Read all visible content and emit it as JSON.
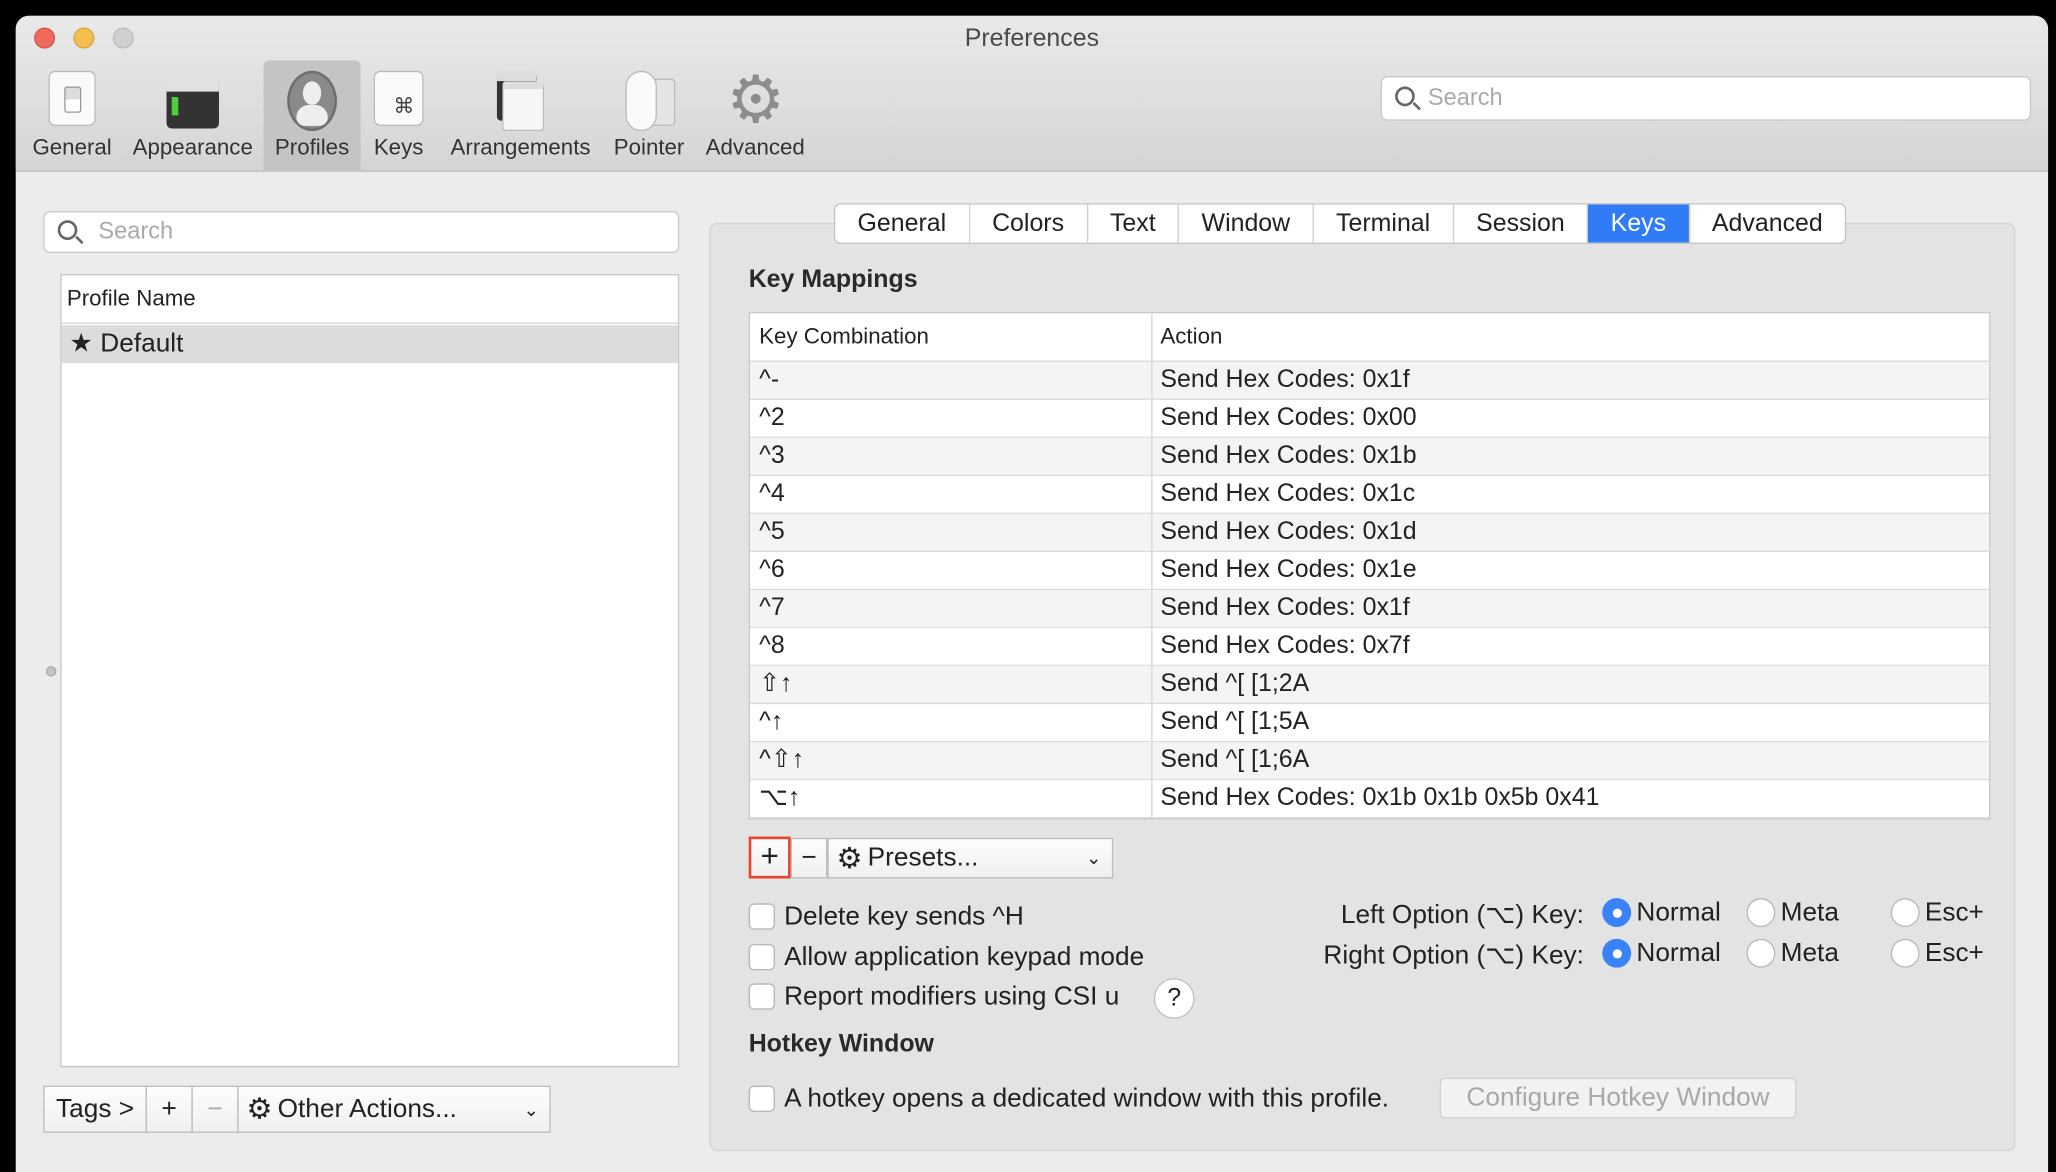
{
  "window": {
    "title": "Preferences"
  },
  "toolbar": {
    "items": [
      {
        "label": "General",
        "icon": "switch-icon"
      },
      {
        "label": "Appearance",
        "icon": "terminal-window-icon"
      },
      {
        "label": "Profiles",
        "icon": "person-icon",
        "selected": true
      },
      {
        "label": "Keys",
        "icon": "command-key-icon"
      },
      {
        "label": "Arrangements",
        "icon": "windows-icon"
      },
      {
        "label": "Pointer",
        "icon": "mouse-icon"
      },
      {
        "label": "Advanced",
        "icon": "gear-icon"
      }
    ],
    "search_placeholder": "Search"
  },
  "profiles": {
    "search_placeholder": "Search",
    "column": "Profile Name",
    "items": [
      {
        "name": "Default",
        "default": true
      }
    ],
    "tags_label": "Tags >",
    "add_label": "+",
    "remove_label": "−",
    "other_actions_label": "Other Actions..."
  },
  "tabs": [
    {
      "label": "General"
    },
    {
      "label": "Colors"
    },
    {
      "label": "Text"
    },
    {
      "label": "Window"
    },
    {
      "label": "Terminal"
    },
    {
      "label": "Session"
    },
    {
      "label": "Keys",
      "selected": true
    },
    {
      "label": "Advanced"
    }
  ],
  "key_mappings": {
    "title": "Key Mappings",
    "columns": [
      "Key Combination",
      "Action"
    ],
    "rows": [
      {
        "key": "^-",
        "action": "Send Hex Codes: 0x1f"
      },
      {
        "key": "^2",
        "action": "Send Hex Codes: 0x00"
      },
      {
        "key": "^3",
        "action": "Send Hex Codes: 0x1b"
      },
      {
        "key": "^4",
        "action": "Send Hex Codes: 0x1c"
      },
      {
        "key": "^5",
        "action": "Send Hex Codes: 0x1d"
      },
      {
        "key": "^6",
        "action": "Send Hex Codes: 0x1e"
      },
      {
        "key": "^7",
        "action": "Send Hex Codes: 0x1f"
      },
      {
        "key": "^8",
        "action": "Send Hex Codes: 0x7f"
      },
      {
        "key": "⇧↑",
        "action": "Send ^[ [1;2A"
      },
      {
        "key": "^↑",
        "action": "Send ^[ [1;5A"
      },
      {
        "key": "^⇧↑",
        "action": "Send ^[ [1;6A"
      },
      {
        "key": "⌥↑",
        "action": "Send Hex Codes: 0x1b 0x1b 0x5b 0x41"
      }
    ],
    "add_label": "+",
    "remove_label": "−",
    "presets_label": "Presets..."
  },
  "options": {
    "delete_sends_h": {
      "label": "Delete key sends ^H",
      "checked": false
    },
    "keypad_mode": {
      "label": "Allow application keypad mode",
      "checked": false
    },
    "csi_u": {
      "label": "Report modifiers using CSI u",
      "checked": false
    },
    "help_label": "?",
    "left_option": {
      "label": "Left Option (⌥) Key:",
      "choices": [
        "Normal",
        "Meta",
        "Esc+"
      ],
      "selected": "Normal"
    },
    "right_option": {
      "label": "Right Option (⌥) Key:",
      "choices": [
        "Normal",
        "Meta",
        "Esc+"
      ],
      "selected": "Normal"
    }
  },
  "hotkey": {
    "title": "Hotkey Window",
    "checkbox_label": "A hotkey opens a dedicated window with this profile.",
    "checked": false,
    "configure_label": "Configure Hotkey Window"
  },
  "colors": {
    "accent": "#2f7cf6",
    "highlight_outline": "#e8452c"
  }
}
